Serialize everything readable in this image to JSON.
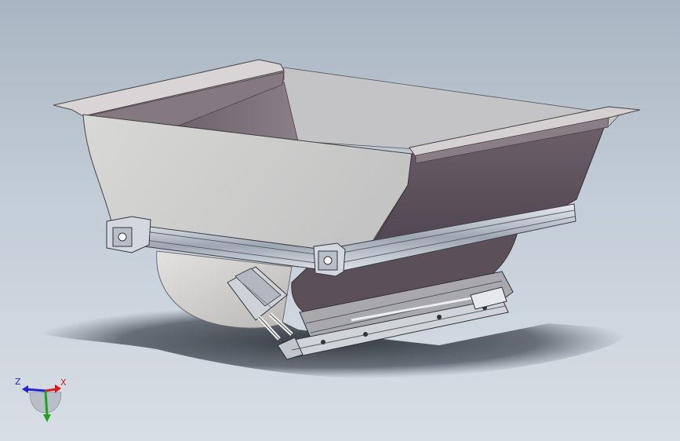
{
  "viewport": {
    "model": "hopper-assembly",
    "background_top": "#a9b5c2",
    "background_bottom": "#d8dee5"
  },
  "triad": {
    "z_label": "Z",
    "x_label": "X",
    "z_color": "#2323d6",
    "x_color": "#d21e1e",
    "y_color": "#1fa31f"
  }
}
